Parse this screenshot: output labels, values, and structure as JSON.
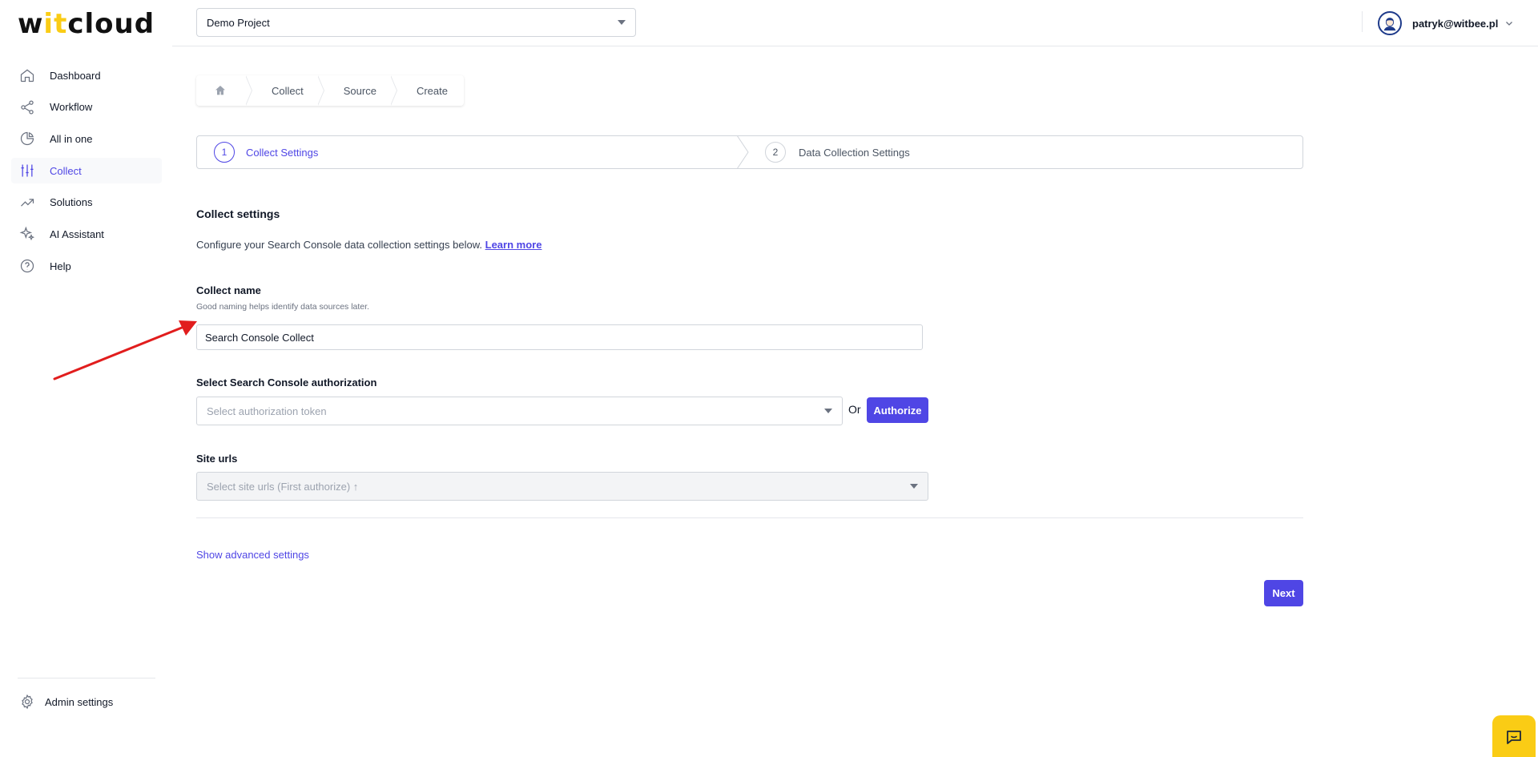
{
  "app": {
    "logo": {
      "pre": "w",
      "accent": "it",
      "post": "cloud"
    }
  },
  "sidebar": {
    "items": [
      {
        "label": "Dashboard",
        "icon": "home-icon"
      },
      {
        "label": "Workflow",
        "icon": "share-icon"
      },
      {
        "label": "All in one",
        "icon": "pie-chart-icon"
      },
      {
        "label": "Collect",
        "icon": "sliders-icon",
        "active": true
      },
      {
        "label": "Solutions",
        "icon": "trending-up-icon"
      },
      {
        "label": "AI Assistant",
        "icon": "sparkles-icon"
      },
      {
        "label": "Help",
        "icon": "help-circle-icon"
      }
    ],
    "admin_label": "Admin settings"
  },
  "header": {
    "project": "Demo Project",
    "user_email": "patryk@witbee.pl"
  },
  "breadcrumb": [
    "Collect",
    "Source",
    "Create"
  ],
  "steps": [
    {
      "num": "1",
      "label": "Collect Settings",
      "active": true
    },
    {
      "num": "2",
      "label": "Data Collection Settings",
      "active": false
    }
  ],
  "form": {
    "title": "Collect settings",
    "description": "Configure your Search Console data collection settings below.",
    "learn_more": "Learn more",
    "collect_name": {
      "label": "Collect name",
      "help": "Good naming helps identify data sources later.",
      "value": "Search Console Collect"
    },
    "authorization": {
      "label": "Select Search Console authorization",
      "placeholder": "Select authorization token",
      "or": "Or",
      "button": "Authorize"
    },
    "site_urls": {
      "label": "Site urls",
      "placeholder": "Select site urls (First authorize) ↑"
    },
    "advanced_link": "Show advanced settings",
    "next_button": "Next"
  },
  "colors": {
    "accent": "#4f46e5",
    "brand_yellow": "#facc15",
    "annotation_arrow": "#e11d1d"
  }
}
